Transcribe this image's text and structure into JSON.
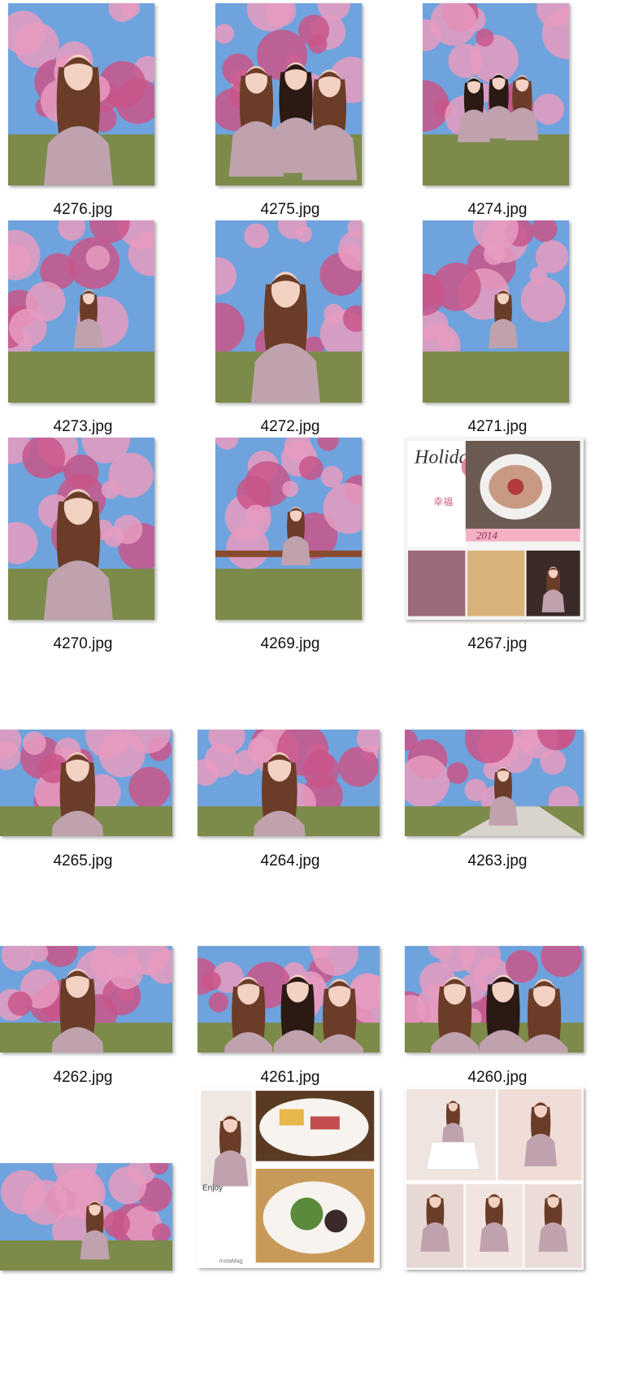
{
  "files": [
    {
      "name": "4276.jpg",
      "kind": "portrait-selfie"
    },
    {
      "name": "4275.jpg",
      "kind": "group-selfie"
    },
    {
      "name": "4274.jpg",
      "kind": "group-standing"
    },
    {
      "name": "4273.jpg",
      "kind": "full-body"
    },
    {
      "name": "4272.jpg",
      "kind": "portrait-selfie"
    },
    {
      "name": "4271.jpg",
      "kind": "full-body"
    },
    {
      "name": "4270.jpg",
      "kind": "portrait-selfie"
    },
    {
      "name": "4269.jpg",
      "kind": "balcony"
    },
    {
      "name": "4267.jpg",
      "kind": "collage-holiday"
    },
    {
      "name": "4265.jpg",
      "kind": "landscape-selfie"
    },
    {
      "name": "4264.jpg",
      "kind": "landscape-selfie"
    },
    {
      "name": "4263.jpg",
      "kind": "landscape-path"
    },
    {
      "name": "4262.jpg",
      "kind": "landscape-selfie"
    },
    {
      "name": "4261.jpg",
      "kind": "landscape-group"
    },
    {
      "name": "4260.jpg",
      "kind": "landscape-group"
    },
    {
      "name": "",
      "kind": "landscape-trees"
    },
    {
      "name": "",
      "kind": "collage-food"
    },
    {
      "name": "",
      "kind": "collage-dress"
    }
  ],
  "collage_text": {
    "holiday": "Holiday",
    "happiness": "幸福",
    "year": "2014",
    "enjoy": "Enjoy",
    "instamag": "InstaMag"
  },
  "colors": {
    "sky": "#6fa3dd",
    "blossom": "#e79bbf",
    "blossom_dark": "#c9568a",
    "ground": "#7c8a4a",
    "hair": "#6b3d28",
    "skin": "#f3d2c4",
    "cardigan": "#bfa2ad"
  }
}
